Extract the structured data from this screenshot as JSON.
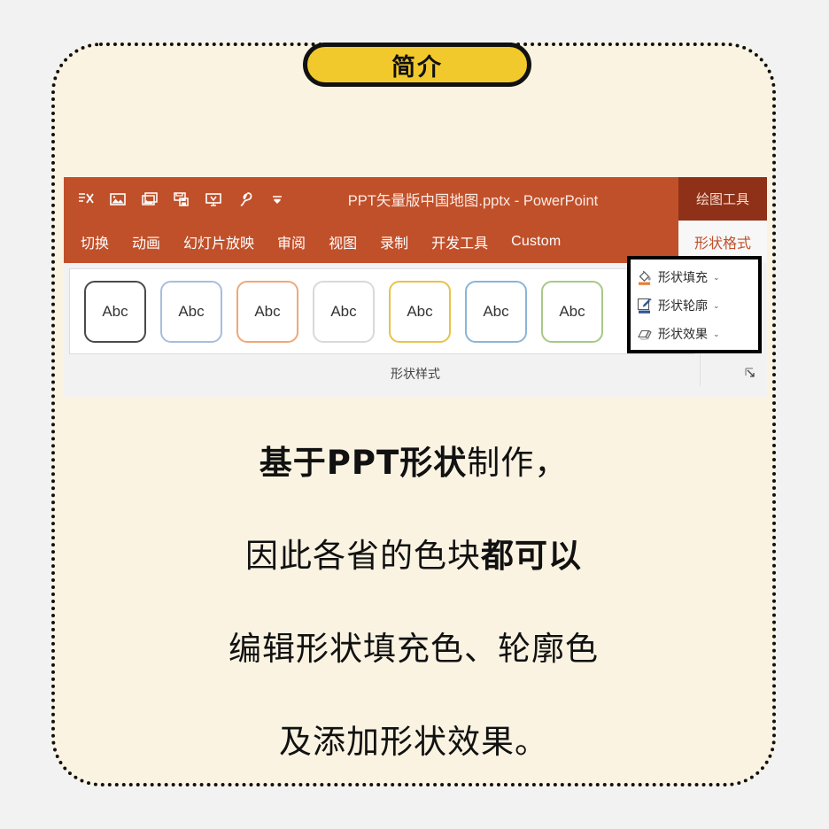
{
  "page": {
    "background": "#f2f2f2",
    "card_background": "#faf3e2"
  },
  "badge": {
    "label": "简介",
    "fill": "#f2c92c",
    "border": "#111111"
  },
  "powerpoint": {
    "titlebar": {
      "background": "#c0502a",
      "document_title": "PPT矢量版中国地图.pptx  -  PowerPoint",
      "context_tab": "绘图工具",
      "quick_access": [
        {
          "name": "cut-x-icon",
          "glyph": "cut"
        },
        {
          "name": "picture-icon",
          "glyph": "picture"
        },
        {
          "name": "pictures-icon",
          "glyph": "pictures"
        },
        {
          "name": "save-as-icon",
          "glyph": "saveas"
        },
        {
          "name": "presentation-icon",
          "glyph": "screen"
        },
        {
          "name": "bird-brush-icon",
          "glyph": "bird"
        },
        {
          "name": "customize-toolbar-icon",
          "glyph": "chev"
        }
      ]
    },
    "tabs": [
      {
        "label": "切换",
        "active": false,
        "latin": false
      },
      {
        "label": "动画",
        "active": false,
        "latin": false
      },
      {
        "label": "幻灯片放映",
        "active": false,
        "latin": false
      },
      {
        "label": "审阅",
        "active": false,
        "latin": false
      },
      {
        "label": "视图",
        "active": false,
        "latin": false
      },
      {
        "label": "录制",
        "active": false,
        "latin": false
      },
      {
        "label": "开发工具",
        "active": false,
        "latin": false
      },
      {
        "label": "Custom",
        "active": false,
        "latin": true
      }
    ],
    "active_tab": "形状格式",
    "shape_styles": {
      "group_label": "形状样式",
      "gallery": [
        {
          "label": "Abc",
          "outline": "#4a4a4a"
        },
        {
          "label": "Abc",
          "outline": "#a7bede"
        },
        {
          "label": "Abc",
          "outline": "#f0a878"
        },
        {
          "label": "Abc",
          "outline": "#d9d9d9"
        },
        {
          "label": "Abc",
          "outline": "#e8c34a"
        },
        {
          "label": "Abc",
          "outline": "#8ab5d8"
        },
        {
          "label": "Abc",
          "outline": "#a8c888"
        }
      ],
      "scroll_buttons": [
        "▲",
        "▼",
        "▼"
      ],
      "dialog_launcher": "形状样式对话框"
    },
    "callout": {
      "items": [
        {
          "label": "形状填充",
          "icon": "paint-bucket-icon",
          "accent": "#ed7d31",
          "chevron": "⌄"
        },
        {
          "label": "形状轮廓",
          "icon": "pen-outline-icon",
          "accent": "#2f5597",
          "chevron": "⌄"
        },
        {
          "label": "形状效果",
          "icon": "shape-effects-icon",
          "accent": "#bfbfbf",
          "chevron": "⌄"
        }
      ]
    }
  },
  "copy": {
    "line1_bold": "基于PPT形状",
    "line1_rest": "制作，",
    "line2_rest": "因此各省的色块",
    "line2_bold": "都可以",
    "line3": "编辑形状填充色、轮廓色",
    "line4": "及添加形状效果。"
  }
}
